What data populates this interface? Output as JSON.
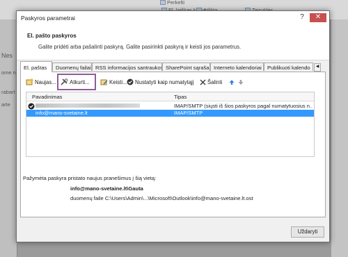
{
  "background_app": {
    "ribbon_items": [
      "Perkelti",
      "El. laiškas koma...",
      "Atlikta",
      "Taisyklės"
    ],
    "side_fragments": [
      "Nes",
      "ome n",
      "rabart",
      "arte"
    ]
  },
  "dialog": {
    "title": "Paskyros parametrai",
    "header_title": "El. pašto paskyros",
    "header_subtitle": "Galite pridėti arba pašalinti paskyrą. Galite pasirinkti paskyrą ir keisti jos parametrus.",
    "tabs": [
      {
        "label": "El. paštas",
        "active": true
      },
      {
        "label": "Duomenų failai"
      },
      {
        "label": "RSS informacijos santraukos"
      },
      {
        "label": "SharePoint sąrašai"
      },
      {
        "label": "Interneto kalendoriai"
      },
      {
        "label": "Publikuoti kalendo"
      }
    ],
    "toolbar": {
      "new": "Naujas...",
      "repair": "Atkurti...",
      "change": "Keisti...",
      "set_default": "Nustatyti kaip numatytąjį",
      "remove": "Šalinti"
    },
    "list": {
      "columns": [
        "Pavadinimas",
        "Tipas"
      ],
      "rows": [
        {
          "name": "",
          "type": "IMAP/SMTP (siųsti iš šios paskyros pagal numatytuosius n...",
          "default": true,
          "selected": false
        },
        {
          "name": "info@mano-svetaine.lt",
          "type": "IMAP/SMTP",
          "default": false,
          "selected": true
        }
      ]
    },
    "delivery_label": "Pažymėta paskyra pristato naujus pranešimus į šią vietą:",
    "delivery_folder": "info@mano-svetaine.lt\\Gauta",
    "delivery_file": "duomenų faile C:\\Users\\Admin\\...\\Microsoft\\Outlook\\info@mano-svetaine.lt.ost",
    "close_label": "Uždaryti",
    "colors": {
      "selection": "#3399ff",
      "highlight_box": "#8e5c99",
      "close_x": "#c75050"
    }
  }
}
